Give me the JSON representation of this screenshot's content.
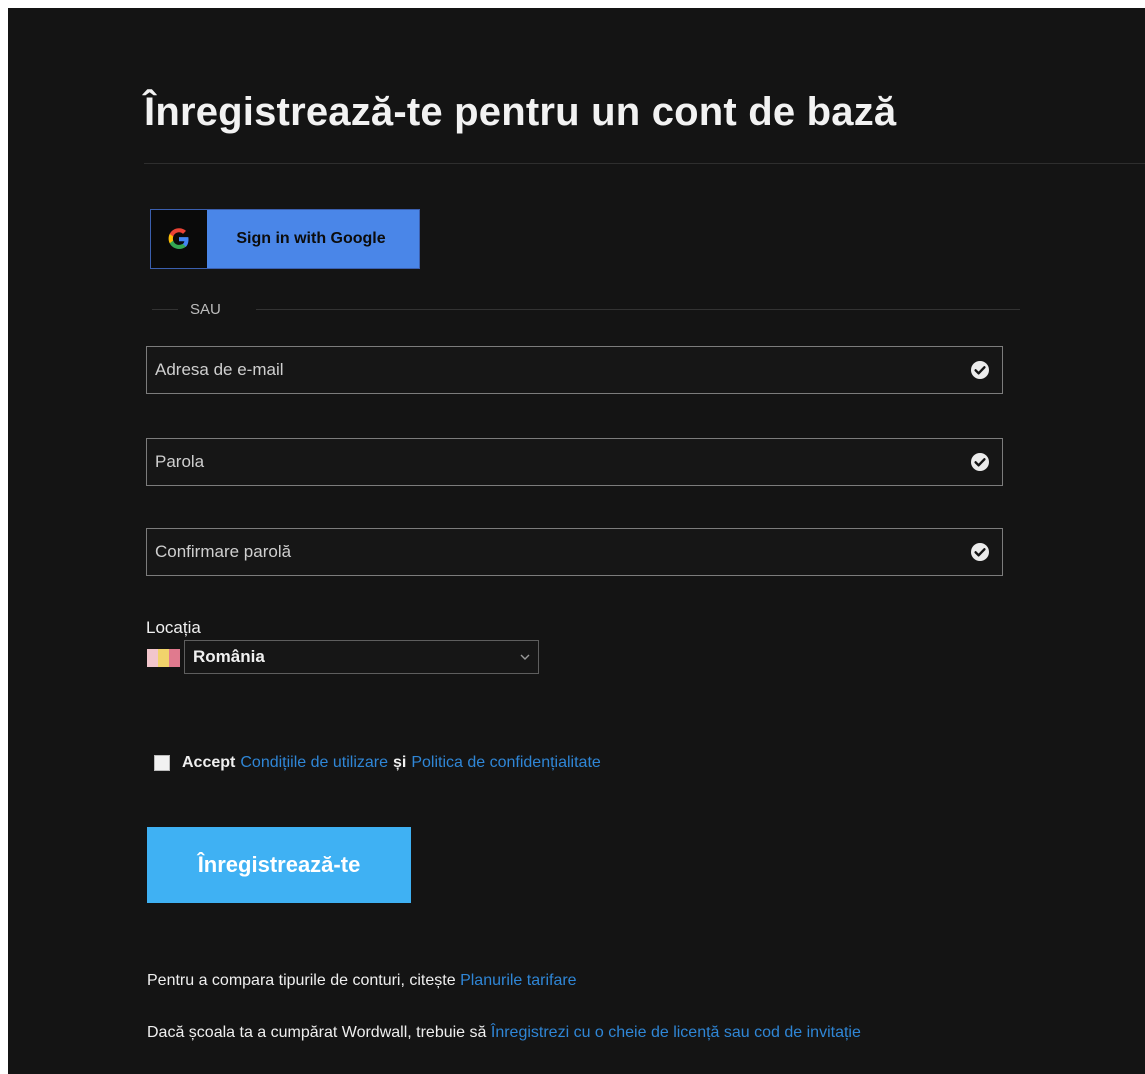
{
  "page": {
    "title": "Înregistrează-te pentru un cont de bază"
  },
  "google_signin": {
    "label": "Sign in with Google",
    "icon": "google-g-icon"
  },
  "divider": {
    "label": "SAU"
  },
  "form": {
    "email": {
      "placeholder": "Adresa de e-mail",
      "value": "",
      "icon": "check-circle-icon"
    },
    "password": {
      "placeholder": "Parola",
      "value": "",
      "icon": "check-circle-icon"
    },
    "confirm_password": {
      "placeholder": "Confirmare parolă",
      "value": "",
      "icon": "check-circle-icon"
    }
  },
  "location": {
    "label": "Locația",
    "selected": "România",
    "flag_colors": [
      "#f2c6cc",
      "#f1d36b",
      "#e07a8e"
    ]
  },
  "terms": {
    "checked": false,
    "prefix": "Accept",
    "terms_link": "Condițiile de utilizare",
    "conjunction": "și",
    "privacy_link": "Politica de confidențialitate"
  },
  "register_button": {
    "label": "Înregistrează-te"
  },
  "footer": {
    "compare_text": "Pentru a compara tipurile de conturi, citește",
    "compare_link": "Planurile tarifare",
    "school_text": "Dacă școala ta a cumpărat Wordwall, trebuie să",
    "school_link": "Înregistrezi cu o cheie de licență sau cod de invitație"
  },
  "colors": {
    "background": "#141414",
    "link": "#2f86d6",
    "primary_button": "#3fb1f3",
    "google_button": "#4a86e8"
  }
}
